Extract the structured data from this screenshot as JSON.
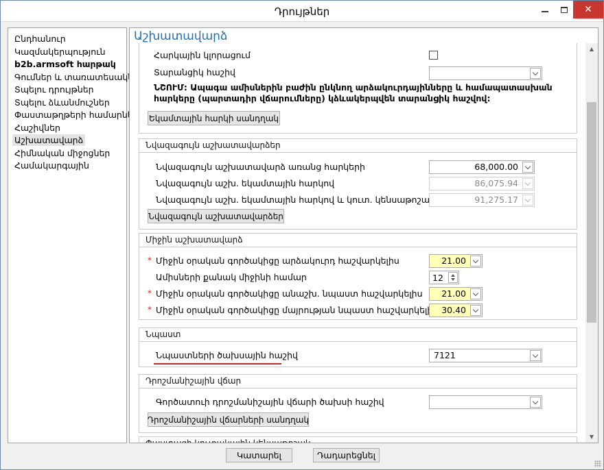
{
  "window": {
    "title": "Դրույթներ",
    "close_glyph": "✕"
  },
  "sidebar": {
    "items": [
      {
        "label": "Ընդհանուր"
      },
      {
        "label": "Կազմակերպություն"
      },
      {
        "label": "b2b.armsoft հարթակ"
      },
      {
        "label": "Գումներ և տառատեսակներ"
      },
      {
        "label": "Տպելու դրույթներ"
      },
      {
        "label": "Տպելու ձևանմուշներ"
      },
      {
        "label": "Փաստաթղթերի համարներ"
      },
      {
        "label": "Հաշիվներ"
      },
      {
        "label": "Աշխատավարձ"
      },
      {
        "label": "Հիմնական միջոցներ"
      },
      {
        "label": "Համակարգային"
      }
    ],
    "selected": "Աշխատավարձ",
    "bold_item": "b2b.armsoft հարթակ"
  },
  "main": {
    "title": "Աշխատավարձ",
    "top_group": {
      "monthly_tax_label": "Հարկային կլորացում",
      "monthly_tax_checked": false,
      "yearly_account_label": "Տարանցիկ հաշիվ",
      "yearly_account_value": "",
      "note": "ՆՇՈՒՄ: Ապագա ամիսներին բաժին ընկնող արձակուրդայինները և համապատասխան հարկերը (պարտադիր վճարումները) կձևակերպվեն տարանցիկ հաշվով:",
      "note_line1": "ՆՇՈՒՄ: Ապագա ամիսներին բաժին ընկնող արձակուրդայինները և համապատասխան",
      "note_line2": "հարկերը (պարտադիր վճարումները) կձևակերպվեն տարանցիկ հաշվով:",
      "button": "Եկամտային հարկի սանդղակ"
    },
    "min_salary": {
      "header": "Նվազագույն աշխատավարձեր",
      "rows": [
        {
          "label": "Նվազագույն աշխատավարձ առանց հարկերի",
          "value": "68,000.00",
          "enabled": true
        },
        {
          "label": "Նվազագույն աշխ. եկամտային հարկով",
          "value": "86,075.94",
          "enabled": false
        },
        {
          "label": "Նվազագույն աշխ. եկամտային հարկով և կուտ. կենսաթոշակով",
          "value": "91,275.17",
          "enabled": false
        }
      ],
      "button": "Նվազագույն աշխատավարձեր"
    },
    "avg_salary": {
      "header": "Միջին աշխատավարձ",
      "rows": [
        {
          "label": "Միջին օրական գործակիցը արձակուրդ հաշվարկելիս",
          "value": "21.00",
          "required": true
        },
        {
          "label": "Ամիսների քանակ միջինի համար",
          "value": "12",
          "required": false
        },
        {
          "label": "Միջին օրական գործակիցը անաշխ. նպաստ հաշվարկելիս",
          "value": "21.00",
          "required": true
        },
        {
          "label": "Միջին օրական գործակիցը մայրության նպաստ հաշվարկելիս",
          "value": "30.40",
          "required": true
        }
      ],
      "required_mark": "*"
    },
    "benefit": {
      "header": "Նպաստ",
      "label": "Նպաստների ծախսային հաշիվ",
      "value": "7121"
    },
    "incentive": {
      "header": "Դրոշմանիշային վճար",
      "label": "Գործատուի դրոշմանիշային վճարի ծախսի հաշիվ",
      "value": "",
      "button": "Դրոշմանիշային վճարների սանդղակ"
    },
    "cut_group_header": "Փաստացի կուտակային կենսաթոշակ"
  },
  "footer": {
    "ok": "Կատարել",
    "cancel": "Դադարեցնել"
  },
  "colors": {
    "title_blue": "#1f6fb2",
    "required_red": "#d11a1a",
    "highlight_yellow": "#ffffb5",
    "close_red": "#c7372f"
  }
}
